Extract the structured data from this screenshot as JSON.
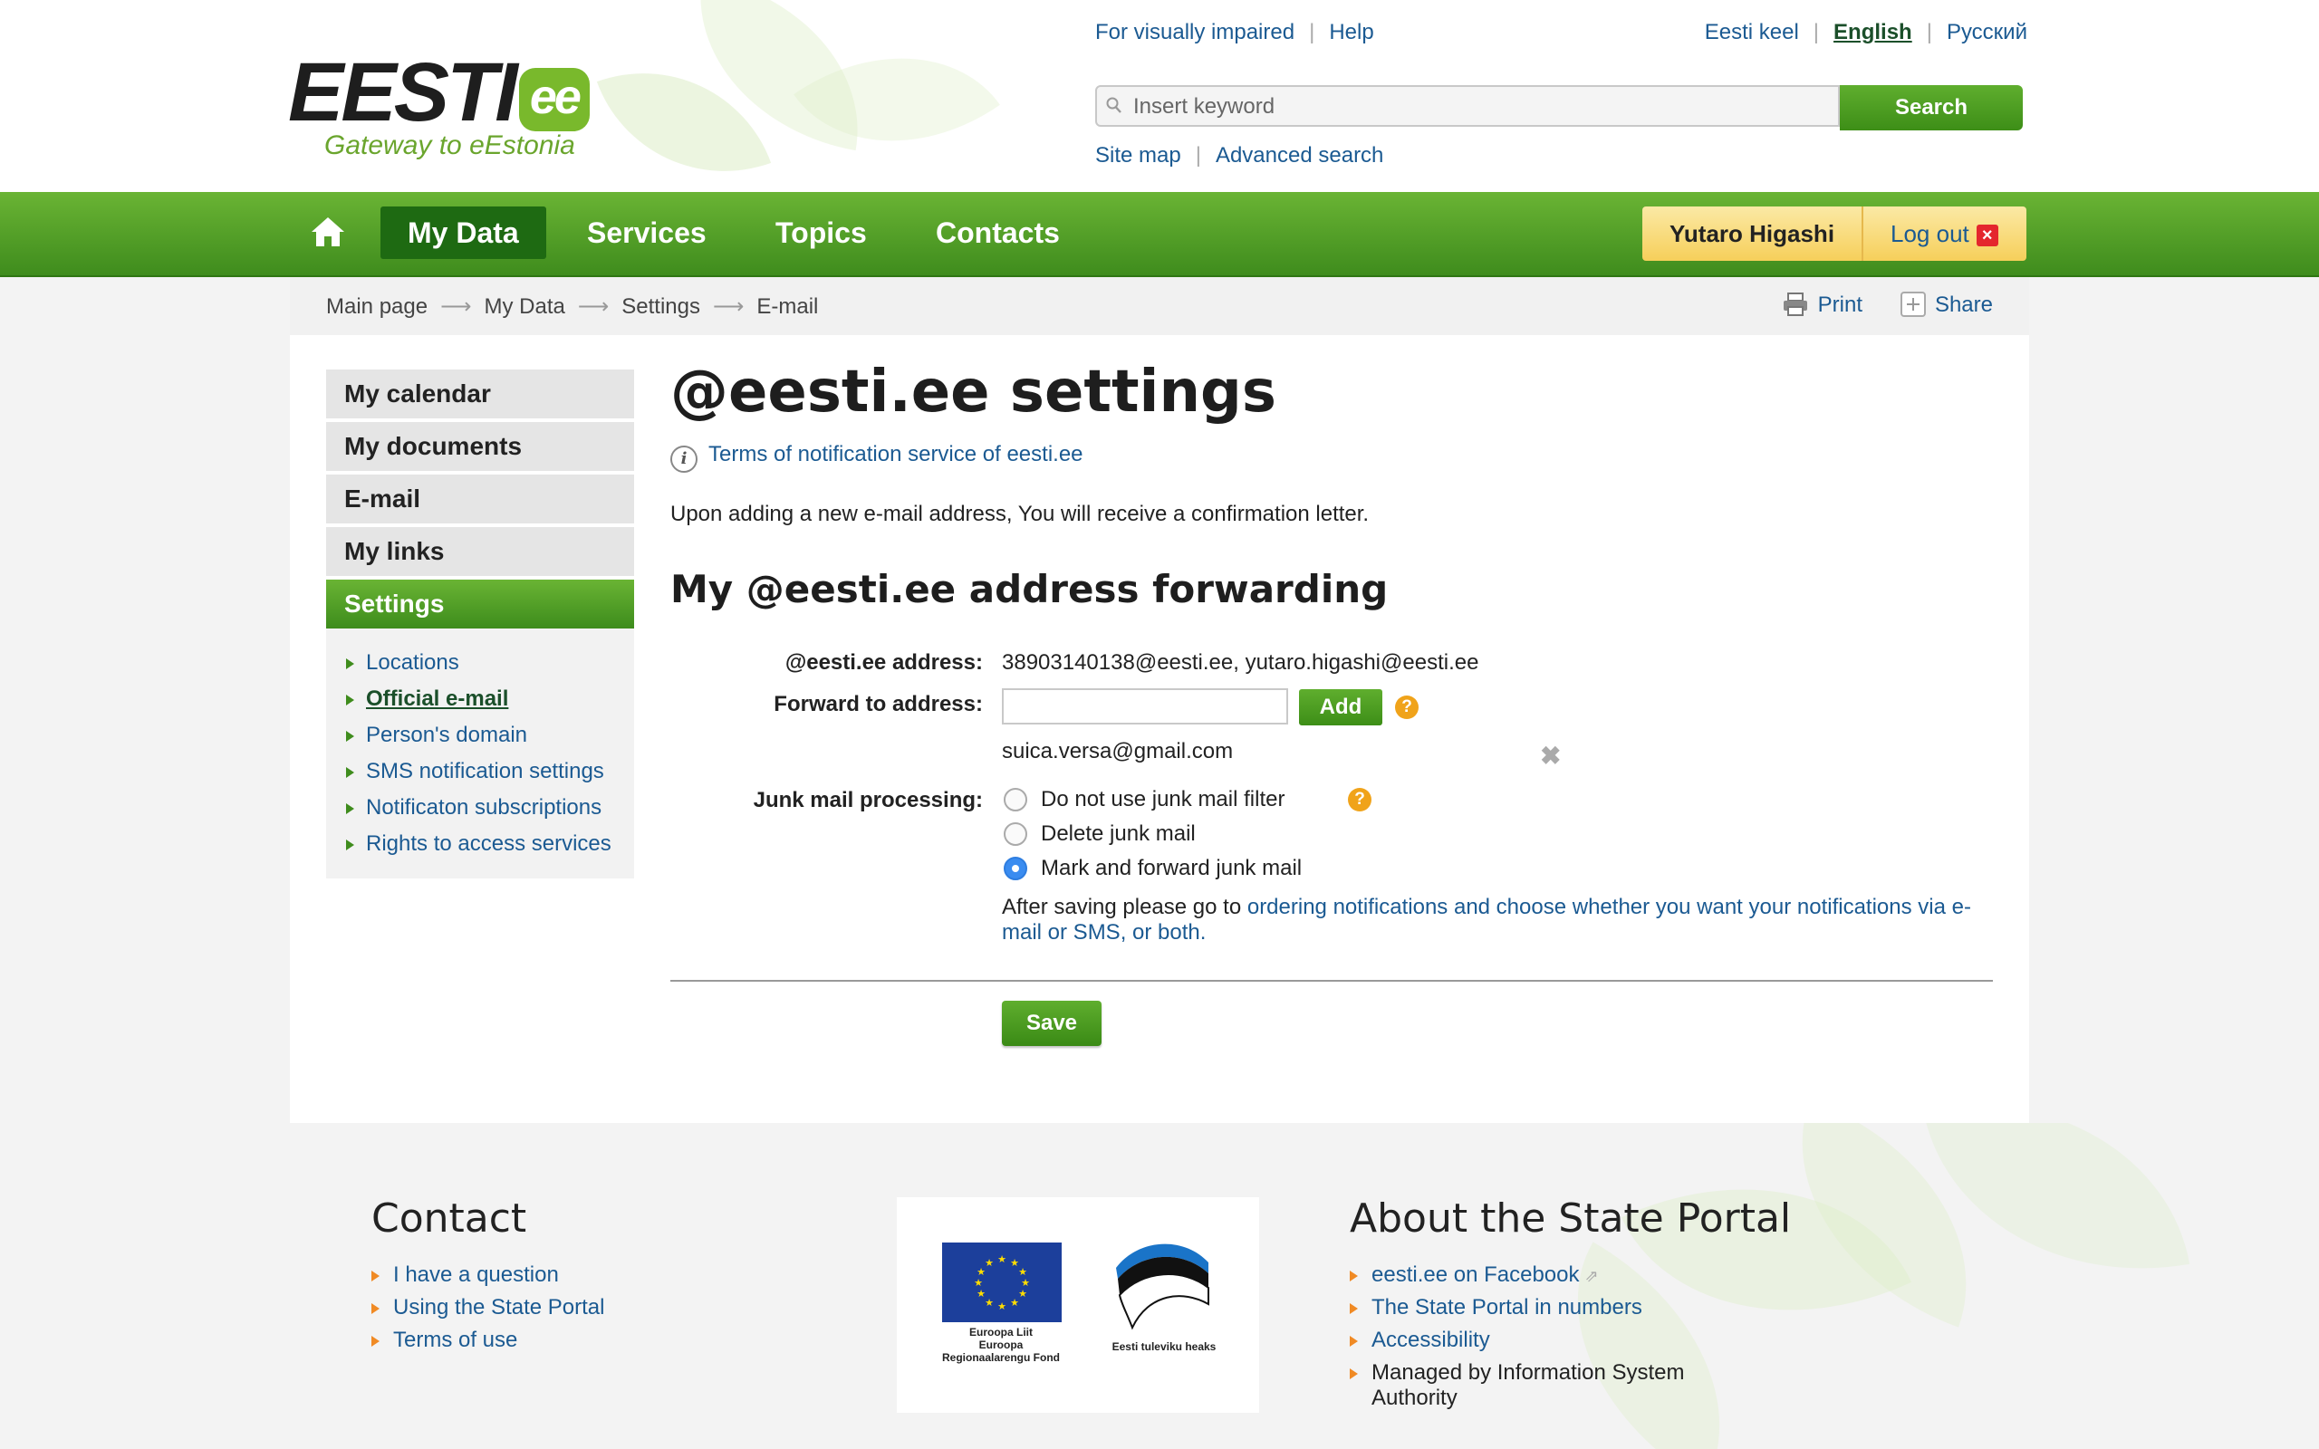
{
  "header": {
    "logo_text": "EESTI",
    "logo_ee": "ee",
    "logo_tagline": "Gateway to eEstonia",
    "top_links": [
      "For visually impaired",
      "Help"
    ],
    "languages": [
      "Eesti keel",
      "English",
      "Русский"
    ],
    "active_language": "English",
    "search": {
      "placeholder": "Insert keyword",
      "value": "",
      "button_label": "Search"
    },
    "sub_links": [
      "Site map",
      "Advanced search"
    ]
  },
  "nav": {
    "items": [
      "My Data",
      "Services",
      "Topics",
      "Contacts"
    ],
    "active": "My Data",
    "user_name": "Yutaro Higashi",
    "logout_label": "Log out",
    "logout_icon": "x-icon"
  },
  "breadcrumb": [
    "Main page",
    "My Data",
    "Settings",
    "E-mail"
  ],
  "page_tools": {
    "print": "Print",
    "share": "Share"
  },
  "sidebar": {
    "items": [
      "My calendar",
      "My documents",
      "E-mail",
      "My links",
      "Settings"
    ],
    "active": "Settings",
    "subitems": [
      "Locations",
      "Official e-mail",
      "Person's domain",
      "SMS notification settings",
      "Notificaton subscriptions",
      "Rights to access services"
    ],
    "active_subitem": "Official e-mail"
  },
  "main": {
    "title": "@eesti.ee settings",
    "terms_link": "Terms of notification service of eesti.ee",
    "confirm_text": "Upon adding a new e-mail address, You will receive a confirmation letter.",
    "section_title": "My @eesti.ee address forwarding",
    "address_label": "@eesti.ee address:",
    "address_value": "38903140138@eesti.ee, yutaro.higashi@eesti.ee",
    "forward_label": "Forward to address:",
    "forward_value": "",
    "add_label": "Add",
    "help_icon_text": "?",
    "forwarded_email": "suica.versa@gmail.com",
    "junk_label": "Junk mail processing:",
    "junk_options": [
      "Do not use junk mail filter",
      "Delete junk mail",
      "Mark and forward junk mail"
    ],
    "junk_selected": "Mark and forward junk mail",
    "after_save_prefix": "After saving please go to ",
    "after_save_link": "ordering notifications and choose whether you want your notifications via e-mail or SMS, or both.",
    "save_label": "Save"
  },
  "footer": {
    "contact_title": "Contact",
    "contact_links": [
      "I have a question",
      "Using the State Portal",
      "Terms of use"
    ],
    "eu_caption": "Euroopa Liit\nEuroopa\nRegionaalarengu Fond",
    "estonia_caption": "Eesti tuleviku heaks",
    "about_title": "About the State Portal",
    "about_links": [
      "eesti.ee on Facebook",
      "The State Portal in numbers",
      "Accessibility"
    ],
    "about_text": "Managed by Information System Authority"
  },
  "colors": {
    "brand_green": "#4a9a22",
    "link_blue": "#1b5a92",
    "user_box": "#f6cf5a",
    "help_orange": "#f0a31a"
  }
}
